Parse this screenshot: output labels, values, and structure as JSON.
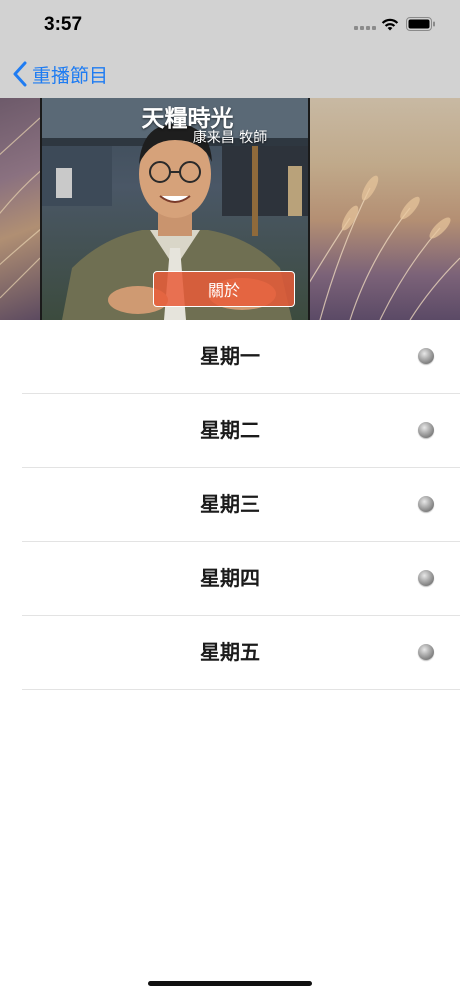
{
  "status_bar": {
    "time": "3:57"
  },
  "nav": {
    "back_label": "重播節目"
  },
  "banner": {
    "title": "天糧時光",
    "subtitle": "康来昌 牧師",
    "about_label": "關於"
  },
  "days": [
    {
      "label": "星期一"
    },
    {
      "label": "星期二"
    },
    {
      "label": "星期三"
    },
    {
      "label": "星期四"
    },
    {
      "label": "星期五"
    }
  ],
  "colors": {
    "accent": "#1f7cf2",
    "bar_background": "#d2d2d2",
    "about_button": "#e85c38"
  },
  "icons": {
    "back": "chevron-left-icon",
    "wifi": "wifi-icon",
    "battery": "battery-icon",
    "status": "status-dot-icon"
  }
}
